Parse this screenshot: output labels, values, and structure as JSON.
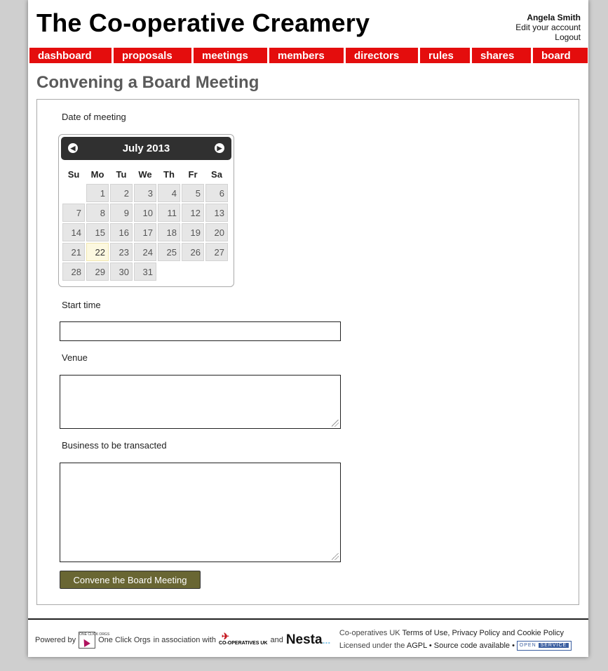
{
  "header": {
    "site_title": "The Co-operative Creamery",
    "user_name": "Angela Smith",
    "edit_account": "Edit your account",
    "logout": "Logout"
  },
  "nav": {
    "items": [
      {
        "label": "dashboard"
      },
      {
        "label": "proposals"
      },
      {
        "label": "meetings"
      },
      {
        "label": "members"
      },
      {
        "label": "directors"
      },
      {
        "label": "rules"
      },
      {
        "label": "shares"
      },
      {
        "label": "board"
      }
    ]
  },
  "main": {
    "page_title": "Convening a Board Meeting",
    "date_label": "Date of meeting",
    "start_time_label": "Start time",
    "start_time_value": "",
    "venue_label": "Venue",
    "venue_value": "",
    "business_label": "Business to be transacted",
    "business_value": "",
    "submit_label": "Convene the Board Meeting"
  },
  "calendar": {
    "month_title": "July 2013",
    "weekdays": [
      "Su",
      "Mo",
      "Tu",
      "We",
      "Th",
      "Fr",
      "Sa"
    ],
    "weeks": [
      [
        "",
        "1",
        "2",
        "3",
        "4",
        "5",
        "6"
      ],
      [
        "7",
        "8",
        "9",
        "10",
        "11",
        "12",
        "13"
      ],
      [
        "14",
        "15",
        "16",
        "17",
        "18",
        "19",
        "20"
      ],
      [
        "21",
        "22",
        "23",
        "24",
        "25",
        "26",
        "27"
      ],
      [
        "28",
        "29",
        "30",
        "31",
        "",
        "",
        ""
      ]
    ],
    "today": "22"
  },
  "footer": {
    "powered_by": "Powered by",
    "oco_name": "One Click Orgs",
    "association": "in association with",
    "coop_logo_text": "CO-OPERATIVES UK",
    "and": "and",
    "nesta_logo_text": "Nesta",
    "oco_logo_text": "ONE CLICK ORGS",
    "coops_uk": "Co-operatives UK",
    "terms": "Terms of Use",
    "privacy": "Privacy Policy",
    "and_word": "and",
    "cookie": "Cookie Policy",
    "licensed": "Licensed under the",
    "agpl": "AGPL",
    "source": "Source code available",
    "badge_open": "OPEN",
    "badge_service": "SERVICE"
  },
  "colors": {
    "nav_red": "#e40d0d",
    "button_olive": "#696633",
    "calendar_header": "#303030"
  }
}
